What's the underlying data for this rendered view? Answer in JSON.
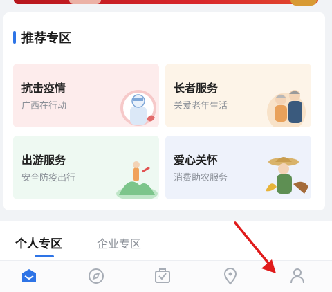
{
  "recommend": {
    "title": "推荐专区",
    "tiles": [
      {
        "title": "抗击疫情",
        "subtitle": "广西在行动",
        "bg": "#fdecec"
      },
      {
        "title": "长者服务",
        "subtitle": "关爱老年生活",
        "bg": "#fdf4e8"
      },
      {
        "title": "出游服务",
        "subtitle": "安全防疫出行",
        "bg": "#eef9f2"
      },
      {
        "title": "爱心关怀",
        "subtitle": "消费助农服务",
        "bg": "#eef2fb"
      }
    ]
  },
  "tabs": {
    "items": [
      {
        "label": "个人专区",
        "active": true
      },
      {
        "label": "企业专区",
        "active": false
      }
    ]
  },
  "bottom_nav": {
    "items": [
      {
        "icon": "home-icon",
        "active": true
      },
      {
        "icon": "compass-icon",
        "active": false
      },
      {
        "icon": "inbox-icon",
        "active": false
      },
      {
        "icon": "location-pin-icon",
        "active": false
      },
      {
        "icon": "user-icon",
        "active": false
      }
    ],
    "active_color": "#2e74e6",
    "inactive_color": "#a7adb6"
  }
}
